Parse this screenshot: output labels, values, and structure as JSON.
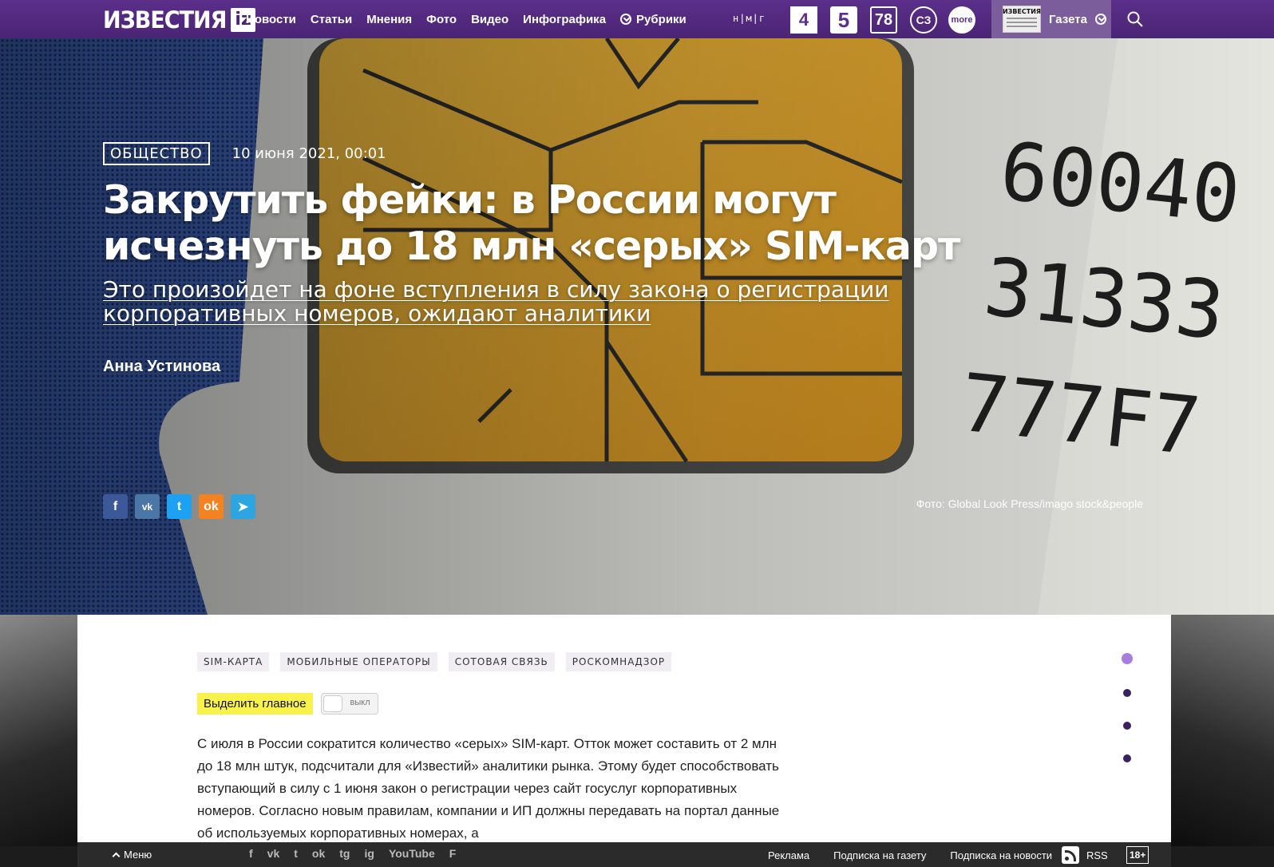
{
  "header": {
    "logo_text": "ИЗВЕСТИЯ",
    "logo_badge": "iz",
    "nav": [
      "Новости",
      "Статьи",
      "Мнения",
      "Фото",
      "Видео",
      "Инфографика"
    ],
    "rubrics_label": "Рубрики",
    "nmg_text": "н|м|г",
    "channels": {
      "ch4": "4",
      "ch5": "5",
      "ch78": "78",
      "zvezda": "СЗ",
      "more": "more"
    },
    "gazeta_thumb": "ИЗВЕСТИЯ",
    "gazeta_label": "Газета",
    "search_icon": "search-icon"
  },
  "hero": {
    "rubric": "ОБЩЕСТВО",
    "date": "10 июня 2021, 00:01",
    "headline": "Закрутить фейки: в России могут исчезнуть до 18 млн «серых» SIM-карт",
    "lede": "Это произойдет на фоне вступления в силу закона о регистрации корпоративных номеров, ожидают аналитики",
    "author": "Анна Устинова",
    "photo_credit": "Фото: Global Look Press/imago stock&people",
    "sim_numbers": [
      "60040",
      "31333",
      "777F7"
    ],
    "share": {
      "fb": "f",
      "vk": "vk",
      "tw": "t",
      "ok": "ok",
      "tg": "➤"
    }
  },
  "article": {
    "tags": [
      "SIM-КАРТА",
      "МОБИЛЬНЫЕ ОПЕРАТОРЫ",
      "СОТОВАЯ СВЯЗЬ",
      "РОСКОМНАДЗОР"
    ],
    "highlight_label": "Выделить главное",
    "toggle_state": "выкл",
    "body": "С июля в России сократится количество «серых» SIM-карт. Отток может составить от 2 млн до 18 млн штук, подсчитали для «Известий» аналитики рынка. Этому будет способствовать вступающий в силу с 1 июня закон о регистрации через сайт госуслуг корпоративных номеров. Согласно новым правилам, компании и ИП должны передавать на портал данные об используемых корпоративных номерах, а"
  },
  "footer": {
    "menu_label": "Меню",
    "social": [
      "f",
      "vk",
      "t",
      "ok",
      "tg",
      "ig",
      "YouTube",
      "F"
    ],
    "links": [
      "Реклама",
      "Подписка на газету",
      "Подписка на новости"
    ],
    "rss_label": "RSS",
    "age_label": "18+"
  },
  "colors": {
    "brand_purple": "#4a2475",
    "highlight_yellow": "#f8f24a",
    "active_dot": "#a97de0"
  }
}
